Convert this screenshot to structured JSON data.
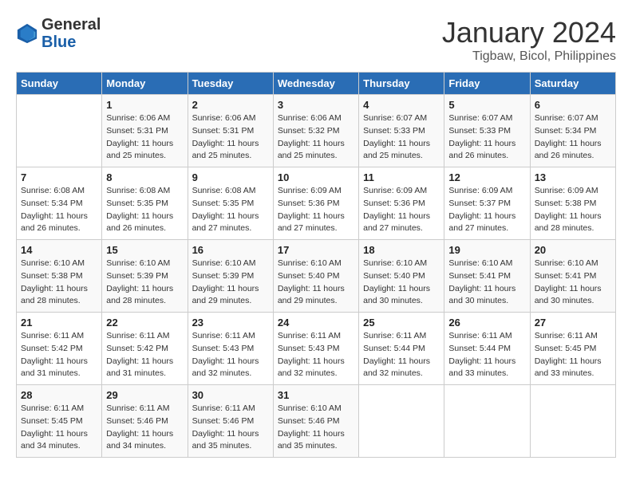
{
  "header": {
    "logo_general": "General",
    "logo_blue": "Blue",
    "title": "January 2024",
    "location": "Tigbaw, Bicol, Philippines"
  },
  "weekdays": [
    "Sunday",
    "Monday",
    "Tuesday",
    "Wednesday",
    "Thursday",
    "Friday",
    "Saturday"
  ],
  "weeks": [
    [
      {
        "day": "",
        "sunrise": "",
        "sunset": "",
        "daylight": ""
      },
      {
        "day": "1",
        "sunrise": "Sunrise: 6:06 AM",
        "sunset": "Sunset: 5:31 PM",
        "daylight": "Daylight: 11 hours and 25 minutes."
      },
      {
        "day": "2",
        "sunrise": "Sunrise: 6:06 AM",
        "sunset": "Sunset: 5:31 PM",
        "daylight": "Daylight: 11 hours and 25 minutes."
      },
      {
        "day": "3",
        "sunrise": "Sunrise: 6:06 AM",
        "sunset": "Sunset: 5:32 PM",
        "daylight": "Daylight: 11 hours and 25 minutes."
      },
      {
        "day": "4",
        "sunrise": "Sunrise: 6:07 AM",
        "sunset": "Sunset: 5:33 PM",
        "daylight": "Daylight: 11 hours and 25 minutes."
      },
      {
        "day": "5",
        "sunrise": "Sunrise: 6:07 AM",
        "sunset": "Sunset: 5:33 PM",
        "daylight": "Daylight: 11 hours and 26 minutes."
      },
      {
        "day": "6",
        "sunrise": "Sunrise: 6:07 AM",
        "sunset": "Sunset: 5:34 PM",
        "daylight": "Daylight: 11 hours and 26 minutes."
      }
    ],
    [
      {
        "day": "7",
        "sunrise": "Sunrise: 6:08 AM",
        "sunset": "Sunset: 5:34 PM",
        "daylight": "Daylight: 11 hours and 26 minutes."
      },
      {
        "day": "8",
        "sunrise": "Sunrise: 6:08 AM",
        "sunset": "Sunset: 5:35 PM",
        "daylight": "Daylight: 11 hours and 26 minutes."
      },
      {
        "day": "9",
        "sunrise": "Sunrise: 6:08 AM",
        "sunset": "Sunset: 5:35 PM",
        "daylight": "Daylight: 11 hours and 27 minutes."
      },
      {
        "day": "10",
        "sunrise": "Sunrise: 6:09 AM",
        "sunset": "Sunset: 5:36 PM",
        "daylight": "Daylight: 11 hours and 27 minutes."
      },
      {
        "day": "11",
        "sunrise": "Sunrise: 6:09 AM",
        "sunset": "Sunset: 5:36 PM",
        "daylight": "Daylight: 11 hours and 27 minutes."
      },
      {
        "day": "12",
        "sunrise": "Sunrise: 6:09 AM",
        "sunset": "Sunset: 5:37 PM",
        "daylight": "Daylight: 11 hours and 27 minutes."
      },
      {
        "day": "13",
        "sunrise": "Sunrise: 6:09 AM",
        "sunset": "Sunset: 5:38 PM",
        "daylight": "Daylight: 11 hours and 28 minutes."
      }
    ],
    [
      {
        "day": "14",
        "sunrise": "Sunrise: 6:10 AM",
        "sunset": "Sunset: 5:38 PM",
        "daylight": "Daylight: 11 hours and 28 minutes."
      },
      {
        "day": "15",
        "sunrise": "Sunrise: 6:10 AM",
        "sunset": "Sunset: 5:39 PM",
        "daylight": "Daylight: 11 hours and 28 minutes."
      },
      {
        "day": "16",
        "sunrise": "Sunrise: 6:10 AM",
        "sunset": "Sunset: 5:39 PM",
        "daylight": "Daylight: 11 hours and 29 minutes."
      },
      {
        "day": "17",
        "sunrise": "Sunrise: 6:10 AM",
        "sunset": "Sunset: 5:40 PM",
        "daylight": "Daylight: 11 hours and 29 minutes."
      },
      {
        "day": "18",
        "sunrise": "Sunrise: 6:10 AM",
        "sunset": "Sunset: 5:40 PM",
        "daylight": "Daylight: 11 hours and 30 minutes."
      },
      {
        "day": "19",
        "sunrise": "Sunrise: 6:10 AM",
        "sunset": "Sunset: 5:41 PM",
        "daylight": "Daylight: 11 hours and 30 minutes."
      },
      {
        "day": "20",
        "sunrise": "Sunrise: 6:10 AM",
        "sunset": "Sunset: 5:41 PM",
        "daylight": "Daylight: 11 hours and 30 minutes."
      }
    ],
    [
      {
        "day": "21",
        "sunrise": "Sunrise: 6:11 AM",
        "sunset": "Sunset: 5:42 PM",
        "daylight": "Daylight: 11 hours and 31 minutes."
      },
      {
        "day": "22",
        "sunrise": "Sunrise: 6:11 AM",
        "sunset": "Sunset: 5:42 PM",
        "daylight": "Daylight: 11 hours and 31 minutes."
      },
      {
        "day": "23",
        "sunrise": "Sunrise: 6:11 AM",
        "sunset": "Sunset: 5:43 PM",
        "daylight": "Daylight: 11 hours and 32 minutes."
      },
      {
        "day": "24",
        "sunrise": "Sunrise: 6:11 AM",
        "sunset": "Sunset: 5:43 PM",
        "daylight": "Daylight: 11 hours and 32 minutes."
      },
      {
        "day": "25",
        "sunrise": "Sunrise: 6:11 AM",
        "sunset": "Sunset: 5:44 PM",
        "daylight": "Daylight: 11 hours and 32 minutes."
      },
      {
        "day": "26",
        "sunrise": "Sunrise: 6:11 AM",
        "sunset": "Sunset: 5:44 PM",
        "daylight": "Daylight: 11 hours and 33 minutes."
      },
      {
        "day": "27",
        "sunrise": "Sunrise: 6:11 AM",
        "sunset": "Sunset: 5:45 PM",
        "daylight": "Daylight: 11 hours and 33 minutes."
      }
    ],
    [
      {
        "day": "28",
        "sunrise": "Sunrise: 6:11 AM",
        "sunset": "Sunset: 5:45 PM",
        "daylight": "Daylight: 11 hours and 34 minutes."
      },
      {
        "day": "29",
        "sunrise": "Sunrise: 6:11 AM",
        "sunset": "Sunset: 5:46 PM",
        "daylight": "Daylight: 11 hours and 34 minutes."
      },
      {
        "day": "30",
        "sunrise": "Sunrise: 6:11 AM",
        "sunset": "Sunset: 5:46 PM",
        "daylight": "Daylight: 11 hours and 35 minutes."
      },
      {
        "day": "31",
        "sunrise": "Sunrise: 6:10 AM",
        "sunset": "Sunset: 5:46 PM",
        "daylight": "Daylight: 11 hours and 35 minutes."
      },
      {
        "day": "",
        "sunrise": "",
        "sunset": "",
        "daylight": ""
      },
      {
        "day": "",
        "sunrise": "",
        "sunset": "",
        "daylight": ""
      },
      {
        "day": "",
        "sunrise": "",
        "sunset": "",
        "daylight": ""
      }
    ]
  ]
}
